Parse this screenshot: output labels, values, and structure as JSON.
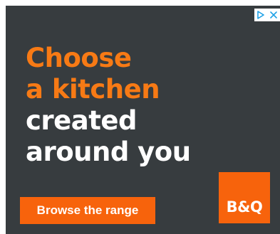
{
  "ad": {
    "background": "#373c3f",
    "headline": {
      "line1": "Choose",
      "line2": "a kitchen",
      "line3": "created",
      "line4": "around you"
    },
    "cta_label": "Browse the range",
    "logo_text": "B&Q",
    "adchoices": {
      "icons": [
        "adchoices-play-icon",
        "close-icon"
      ],
      "color": "#1ea1e6"
    },
    "colors": {
      "accent_text": "#f77a15",
      "accent_fill": "#f7630c",
      "text": "#ffffff"
    }
  }
}
